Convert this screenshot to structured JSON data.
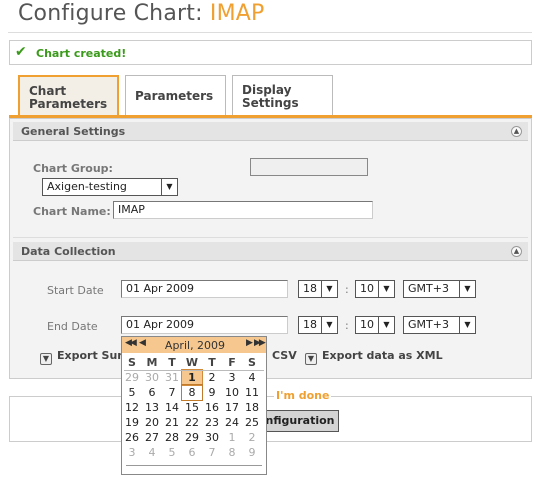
{
  "page": {
    "title_prefix": "Configure Chart:",
    "title_name": "IMAP"
  },
  "notice": {
    "icon": "checkmark-icon",
    "message": "Chart created!"
  },
  "tabs": [
    {
      "label": "Chart Parameters",
      "active": true
    },
    {
      "label": "Parameters",
      "active": false
    },
    {
      "label": "Display Settings",
      "active": false
    }
  ],
  "general": {
    "heading": "General Settings",
    "chart_group_label": "Chart Group:",
    "chart_group_value": "",
    "group_select": "Axigen-testing",
    "chart_name_label": "Chart Name:",
    "chart_name_value": "IMAP"
  },
  "data_collection": {
    "heading": "Data Collection",
    "start_label": "Start Date",
    "start_date": "01 Apr 2009",
    "start_hour": "18",
    "start_minute": "10",
    "start_tz": "GMT+3",
    "end_label": "End Date",
    "end_date": "01 Apr 2009",
    "end_hour": "18",
    "end_minute": "10",
    "end_tz": "GMT+3",
    "export_summary": "Export Sum",
    "export_csv": "CSV",
    "export_xml": "Export data as XML"
  },
  "done": {
    "label": "I'm done",
    "button": "onfiguration"
  },
  "calendar": {
    "month": "April, 2009",
    "nav_prev_year": "◀◀",
    "nav_prev_month": "◀",
    "nav_next_month": "▶",
    "nav_next_year": "▶▶",
    "weekdays": [
      "S",
      "M",
      "T",
      "W",
      "T",
      "F",
      "S"
    ],
    "weeks": [
      [
        "29",
        "30",
        "31",
        "1",
        "2",
        "3",
        "4"
      ],
      [
        "5",
        "6",
        "7",
        "8",
        "9",
        "10",
        "11"
      ],
      [
        "12",
        "13",
        "14",
        "15",
        "16",
        "17",
        "18"
      ],
      [
        "19",
        "20",
        "21",
        "22",
        "23",
        "24",
        "25"
      ],
      [
        "26",
        "27",
        "28",
        "29",
        "30",
        "1",
        "2"
      ],
      [
        "3",
        "4",
        "5",
        "6",
        "7",
        "8",
        "9"
      ]
    ],
    "selected_day": "1",
    "highlighted_day": "8"
  },
  "colors": {
    "accent": "#f0a030",
    "success": "#3a9a1a"
  }
}
